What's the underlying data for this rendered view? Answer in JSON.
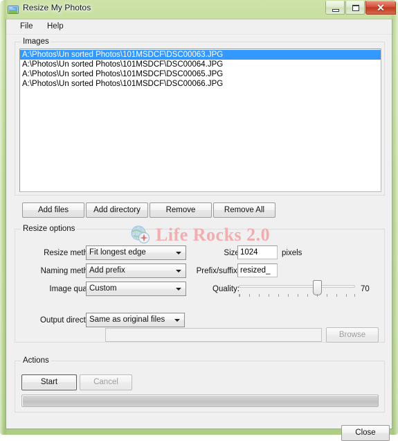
{
  "window": {
    "title": "Resize My Photos",
    "icon": "photo-resize-icon",
    "controls": {
      "minimize": "minimize-icon",
      "maximize": "maximize-icon",
      "close": "✕"
    },
    "frame_color": "#c2dc9a"
  },
  "menu": {
    "items": [
      {
        "label": "File"
      },
      {
        "label": "Help"
      }
    ]
  },
  "images_group": {
    "label": "Images",
    "files": [
      {
        "path": "A:\\Photos\\Un sorted Photos\\101MSDCF\\DSC00063.JPG",
        "selected": true
      },
      {
        "path": "A:\\Photos\\Un sorted Photos\\101MSDCF\\DSC00064.JPG",
        "selected": false
      },
      {
        "path": "A:\\Photos\\Un sorted Photos\\101MSDCF\\DSC00065.JPG",
        "selected": false
      },
      {
        "path": "A:\\Photos\\Un sorted Photos\\101MSDCF\\DSC00066.JPG",
        "selected": false
      }
    ],
    "selection_color": "#3399ff",
    "buttons": {
      "add_files": "Add files",
      "add_directory": "Add directory",
      "remove": "Remove",
      "remove_all": "Remove All"
    }
  },
  "resize_options": {
    "label": "Resize options",
    "resize_method": {
      "label": "Resize method:",
      "value": "Fit longest edge"
    },
    "size": {
      "label": "Size:",
      "value": "1024",
      "unit": "pixels"
    },
    "naming_method": {
      "label": "Naming method:",
      "value": "Add prefix"
    },
    "prefix_suffix": {
      "label": "Prefix/suffix:",
      "value": "resized_"
    },
    "image_quality": {
      "label": "Image quality:",
      "value": "Custom"
    },
    "quality": {
      "label": "Quality:",
      "value": "70",
      "min": "0",
      "max": "100"
    },
    "output_directory": {
      "label": "Output directory:",
      "value": "Same as original files",
      "path_value": "",
      "browse_label": "Browse"
    }
  },
  "actions_group": {
    "label": "Actions",
    "start_label": "Start",
    "cancel_label": "Cancel",
    "progress": "0"
  },
  "footer": {
    "close_label": "Close"
  },
  "watermark": {
    "text": "Life Rocks 2.0",
    "color": "#f2adb0",
    "icon": "globe-compass-icon"
  }
}
